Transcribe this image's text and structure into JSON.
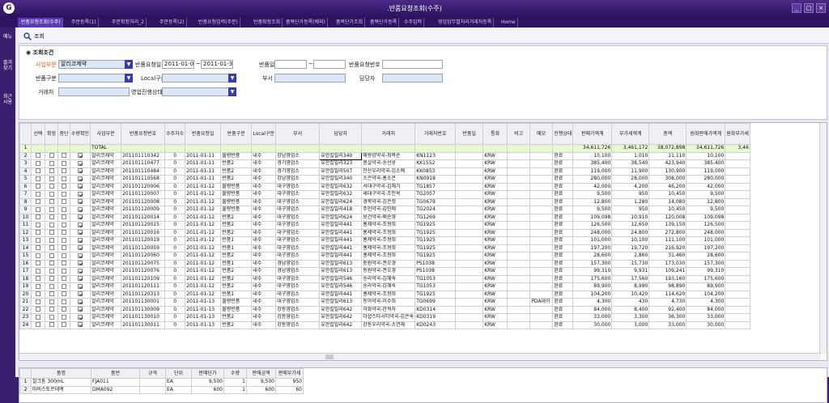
{
  "window": {
    "title": ".반품요청조회(수주)"
  },
  "tabs": [
    ".반품요청조회(수주)",
    "주문등록(1)",
    "주문확정처리_2",
    "주문등록(2)",
    "반품요청입력(주문)",
    "반품확정조회",
    "품목단가등록(예외)",
    "품목단가조회",
    "품목단가등록",
    "수주입력",
    "영업업무별처리거래처등록",
    "Home"
  ],
  "leftbar": [
    "메뉴",
    "즐겨찾기",
    "최근사용"
  ],
  "toolbar": {
    "search_label": "조회"
  },
  "conditions": {
    "title": "조회조건",
    "business_label": "사업부문",
    "business_value": "알리코제약",
    "req_date_label": "반품요청일",
    "req_date_from": "2011-01-01",
    "req_date_sep": "~",
    "req_date_to": "2011-01-30",
    "return_date_label": "반품일",
    "return_date_sep": "~",
    "req_no_label": "반품요청번호",
    "return_type_label": "반품구분",
    "local_label": "Local구분",
    "dept_label": "부서",
    "manager_label": "담당자",
    "client_label": "거래처",
    "status_label": "영업진행상태"
  },
  "grid": {
    "headers": [
      "",
      "선택",
      "확정",
      "중단",
      "수량확인",
      "사업부문",
      "반품요청번호",
      "수주차수",
      "반품요청일",
      "반품구분",
      "Local구분",
      "부서",
      "담당자",
      "거래처",
      "거래처번호",
      "반품일",
      "통화",
      "비고",
      "메모",
      "진행상태",
      "판매가액계",
      "부가세액계",
      "총액",
      "원화판매가액계",
      "원화부가세"
    ],
    "total": {
      "rownum": "1",
      "label": "TOTAL",
      "sales": "34,611,726",
      "vat": "3,461,172",
      "sum": "38,072,898",
      "won_sales": "34,611,726",
      "won_vat": "3,46"
    },
    "rows": [
      [
        "2",
        "알리코제약",
        "201101110342",
        "0",
        "2011-01-11",
        "불량반품",
        "내수",
        "강남영업소",
        "유한킬빌리340",
        "매왕양약국-최복순",
        "KN1123",
        "KRW",
        "",
        "완료",
        "10,100",
        "1,010",
        "11,110",
        "10,100"
      ],
      [
        "3",
        "알리코제약",
        "201101110477",
        "0",
        "2011-01-11",
        "반품2",
        "내수",
        "경기영업소",
        "유한킬빌리323",
        "봉살약국-송선웅",
        "KK1552",
        "KRW",
        "",
        "완료",
        "385,400",
        "38,540",
        "423,940",
        "385,400"
      ],
      [
        "4",
        "알리코제약",
        "201101110484",
        "0",
        "2011-01-11",
        "반품2",
        "내수",
        "경기영업소",
        "유한킬빌리507",
        "안산우리약국-김소예",
        "KK0853",
        "KRW",
        "",
        "완료",
        "119,000",
        "11,900",
        "130,900",
        "119,000"
      ],
      [
        "5",
        "알리코제약",
        "201101110568",
        "0",
        "2011-01-11",
        "반품2",
        "내수",
        "강남영업소",
        "유한킬빌리340",
        "소은약국-홍소은",
        "KN0918",
        "KRW",
        "",
        "완료",
        "280,000",
        "28,000",
        "308,000",
        "280,000"
      ],
      [
        "6",
        "알리코제약",
        "201101120006",
        "0",
        "2011-01-12",
        "불량반품",
        "내수",
        "대구영업소",
        "유한킬빌리632",
        "서대구약국-김해기",
        "TG1857",
        "KRW",
        "",
        "완료",
        "42,000",
        "4,200",
        "46,200",
        "42,000"
      ],
      [
        "7",
        "알리코제약",
        "201101120007",
        "0",
        "2011-01-12",
        "불량반품",
        "내수",
        "대구영업소",
        "유한킬빌리632",
        "새대구약국-조인옥",
        "TG2057",
        "KRW",
        "",
        "완료",
        "9,500",
        "950",
        "10,450",
        "9,500"
      ],
      [
        "8",
        "알리코제약",
        "201101120008",
        "0",
        "2011-01-12",
        "불량반품",
        "내수",
        "대구영업소",
        "유한킬빌리624",
        "경북약국-김은정",
        "TG0679",
        "KRW",
        "",
        "완료",
        "12,800",
        "1,280",
        "14,080",
        "12,800"
      ],
      [
        "9",
        "알리코제약",
        "201101120009",
        "0",
        "2011-01-12",
        "불량반품",
        "내수",
        "대구영업소",
        "유한킬빌리418",
        "주민약국-김인애",
        "TG2024",
        "KRW",
        "",
        "완료",
        "9,500",
        "950",
        "10,450",
        "9,500"
      ],
      [
        "10",
        "알리코제약",
        "201101120014",
        "0",
        "2011-01-12",
        "반품2",
        "내수",
        "대구영업소",
        "유한킬빌리624",
        "보건약국-배순영",
        "TG1269",
        "KRW",
        "",
        "완료",
        "109,098",
        "10,910",
        "120,008",
        "109,098"
      ],
      [
        "11",
        "알리코제약",
        "201101120015",
        "0",
        "2011-01-12",
        "반품2",
        "내수",
        "대구영업소",
        "유한킬빌리441",
        "홍제약국-조형희",
        "TG1925",
        "KRW",
        "",
        "완료",
        "126,500",
        "12,650",
        "139,150",
        "126,500"
      ],
      [
        "12",
        "알리코제약",
        "201101120016",
        "0",
        "2011-01-12",
        "반품2",
        "내수",
        "대구영업소",
        "유한킬빌리441",
        "홍제약국-조형희",
        "TG1925",
        "KRW",
        "",
        "완료",
        "248,000",
        "24,800",
        "272,800",
        "248,000"
      ],
      [
        "13",
        "알리코제약",
        "201101120019",
        "0",
        "2011-01-12",
        "반품1",
        "내수",
        "대구영업소",
        "유한킬빌리441",
        "홍제약국-조형희",
        "TG1925",
        "KRW",
        "",
        "완료",
        "101,000",
        "10,100",
        "111,100",
        "101,000"
      ],
      [
        "14",
        "알리코제약",
        "201101120059",
        "0",
        "2011-01-12",
        "반품1",
        "내수",
        "대구영업소",
        "유한킬빌리441",
        "홍제약국-조형희",
        "TG1925",
        "KRW",
        "",
        "완료",
        "197,200",
        "19,720",
        "216,920",
        "197,200"
      ],
      [
        "15",
        "알리코제약",
        "201101120060",
        "0",
        "2011-01-12",
        "반품2",
        "내수",
        "대구영업소",
        "유한킬빌리441",
        "홍제약국-조형희",
        "TG1925",
        "KRW",
        "",
        "완료",
        "28,600",
        "2,860",
        "31,460",
        "28,600"
      ],
      [
        "16",
        "알리코제약",
        "201101120075",
        "0",
        "2011-01-12",
        "반품1",
        "내수",
        "경남영업소",
        "유한킬빌리613",
        "동원약국-권오경",
        "PS1038",
        "KRW",
        "",
        "완료",
        "157,300",
        "15,730",
        "173,030",
        "157,300"
      ],
      [
        "17",
        "알리코제약",
        "201101120076",
        "0",
        "2011-01-12",
        "반품2",
        "내수",
        "경남영업소",
        "유한킬빌리613",
        "동원약국-권오경",
        "PS1038",
        "KRW",
        "",
        "완료",
        "99,310",
        "9,931",
        "109,241",
        "99,310"
      ],
      [
        "18",
        "알리코제약",
        "201101120109",
        "0",
        "2011-01-12",
        "반품2",
        "내수",
        "대구영업소",
        "유한킬빌리546",
        "송라약국-김혜숙",
        "TG1053",
        "KRW",
        "",
        "완료",
        "175,600",
        "17,560",
        "193,160",
        "175,600"
      ],
      [
        "19",
        "알리코제약",
        "201101120111",
        "0",
        "2011-01-12",
        "반품2",
        "내수",
        "대구영업소",
        "유한킬빌리546",
        "송라약국-김혜숙",
        "TG1053",
        "KRW",
        "",
        "완료",
        "89,900",
        "8,990",
        "98,890",
        "89,900"
      ],
      [
        "20",
        "알리코제약",
        "201101120313",
        "0",
        "2011-01-12",
        "반품1",
        "내수",
        "대구영업소",
        "유한킬빌리441",
        "홍제약국-조형희",
        "TG1925",
        "KRW",
        "",
        "완료",
        "104,200",
        "10,420",
        "114,620",
        "104,200"
      ],
      [
        "21",
        "알리코제약",
        "201101130001",
        "0",
        "2011-01-13",
        "불량반품",
        "내수",
        "대구영업소",
        "유한킬빌리613",
        "동아약국-이수희",
        "TG0699",
        "KRW",
        "PDA데이",
        "완료",
        "4,300",
        "430",
        "4,730",
        "4,300"
      ],
      [
        "22",
        "알리코제약",
        "201101130009",
        "0",
        "2011-01-13",
        "불량반품",
        "내수",
        "강동영업소",
        "유한킬빌리642",
        "이화약국-한혁자",
        "KD0314",
        "KRW",
        "",
        "완료",
        "84,000",
        "8,400",
        "92,400",
        "84,000"
      ],
      [
        "23",
        "알리코제약",
        "201101130010",
        "0",
        "2011-01-13",
        "반품2",
        "내수",
        "강동영업소",
        "유한킬빌리642",
        "더샵스타시티약국-김은숙",
        "KD0319",
        "KRW",
        "",
        "완료",
        "33,000",
        "3,300",
        "36,300",
        "33,000"
      ],
      [
        "24",
        "알리코제약",
        "201101130011",
        "0",
        "2011-01-13",
        "반품2",
        "내수",
        "강동영업소",
        "유한킬빌리642",
        "강동우리약국-소연재",
        "KD0243",
        "KRW",
        "",
        "완료",
        "30,000",
        "3,000",
        "33,000",
        "30,000"
      ]
    ]
  },
  "detail": {
    "headers": [
      "",
      "품명",
      "품번",
      "규격",
      "단위",
      "판매단가",
      "수량",
      "판매금액",
      "판매부가세"
    ],
    "rows": [
      [
        "1",
        "잘크톤 300mL",
        "FJA011",
        "",
        "EA",
        "9,500",
        "1",
        "9,500",
        "950"
      ],
      [
        "2",
        "마비스토르테액",
        "DMA092",
        "",
        "EA",
        "600",
        "1",
        "600",
        "60"
      ]
    ]
  },
  "colors": {
    "frame": "#3a1f6e",
    "active_tab": "#5a3bb5",
    "total_row": "#e9f7d2",
    "required_label": "#d9661a"
  }
}
